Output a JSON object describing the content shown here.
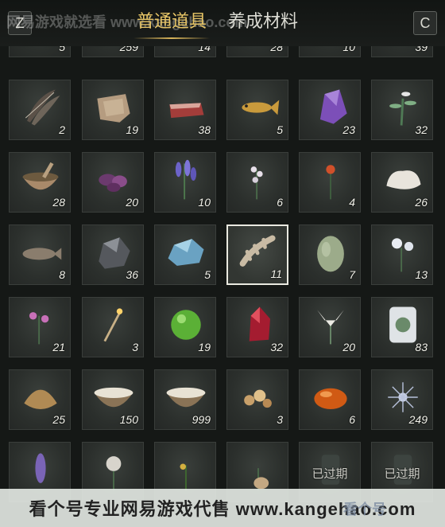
{
  "topbar": {
    "key_left": "Z",
    "key_right": "C",
    "watermark": "网易游戏就选看 www.kangehao.com",
    "tabs": [
      {
        "label": "普通道具",
        "active": true
      },
      {
        "label": "养成材料",
        "active": false
      }
    ]
  },
  "rows": [
    [
      {
        "icon": "feathers",
        "count": "5"
      },
      {
        "icon": "seeds",
        "count": "259"
      },
      {
        "icon": "root",
        "count": "14"
      },
      {
        "icon": "pebbles",
        "count": "28"
      },
      {
        "icon": "blank",
        "count": "10"
      },
      {
        "icon": "leaf",
        "count": "39"
      }
    ],
    [
      {
        "icon": "feathers",
        "count": "2"
      },
      {
        "icon": "hide",
        "count": "19"
      },
      {
        "icon": "meat",
        "count": "38"
      },
      {
        "icon": "fish",
        "count": "5"
      },
      {
        "icon": "amethyst",
        "count": "23"
      },
      {
        "icon": "herb",
        "count": "32"
      }
    ],
    [
      {
        "icon": "mortar",
        "count": "28"
      },
      {
        "icon": "purple-flower",
        "count": "20"
      },
      {
        "icon": "lavender",
        "count": "10"
      },
      {
        "icon": "white-herb",
        "count": "6"
      },
      {
        "icon": "red-flower",
        "count": "4"
      },
      {
        "icon": "wool",
        "count": "26"
      }
    ],
    [
      {
        "icon": "grouper",
        "count": "8"
      },
      {
        "icon": "ore",
        "count": "36"
      },
      {
        "icon": "blue-crystal",
        "count": "5"
      },
      {
        "icon": "bone",
        "count": "11",
        "selected": true
      },
      {
        "icon": "melon",
        "count": "7"
      },
      {
        "icon": "white-rose",
        "count": "13"
      }
    ],
    [
      {
        "icon": "pink-flower",
        "count": "21"
      },
      {
        "icon": "sparkler",
        "count": "3"
      },
      {
        "icon": "green-orb",
        "count": "19"
      },
      {
        "icon": "ruby",
        "count": "32"
      },
      {
        "icon": "lily",
        "count": "20"
      },
      {
        "icon": "jar",
        "count": "83"
      }
    ],
    [
      {
        "icon": "shell",
        "count": "25"
      },
      {
        "icon": "milk-bowl",
        "count": "150"
      },
      {
        "icon": "milk-bowl",
        "count": "999"
      },
      {
        "icon": "nuggets",
        "count": "3"
      },
      {
        "icon": "amber",
        "count": "6"
      },
      {
        "icon": "frost-flower",
        "count": "249"
      }
    ],
    [
      {
        "icon": "hyacinth",
        "count": ""
      },
      {
        "icon": "peony",
        "count": ""
      },
      {
        "icon": "sprout",
        "count": ""
      },
      {
        "icon": "ginseng",
        "count": ""
      },
      {
        "icon": "bottle",
        "count": "",
        "expired": "已过期"
      },
      {
        "icon": "bottle",
        "count": "",
        "expired": "已过期"
      }
    ]
  ],
  "footer": {
    "text": "看个号专业网易游戏代售 www.kangehao.com",
    "brand": "看个号"
  },
  "colors": {
    "tab_active": "#e6c466",
    "background": "#151816",
    "cell": "#2b2f2c"
  }
}
